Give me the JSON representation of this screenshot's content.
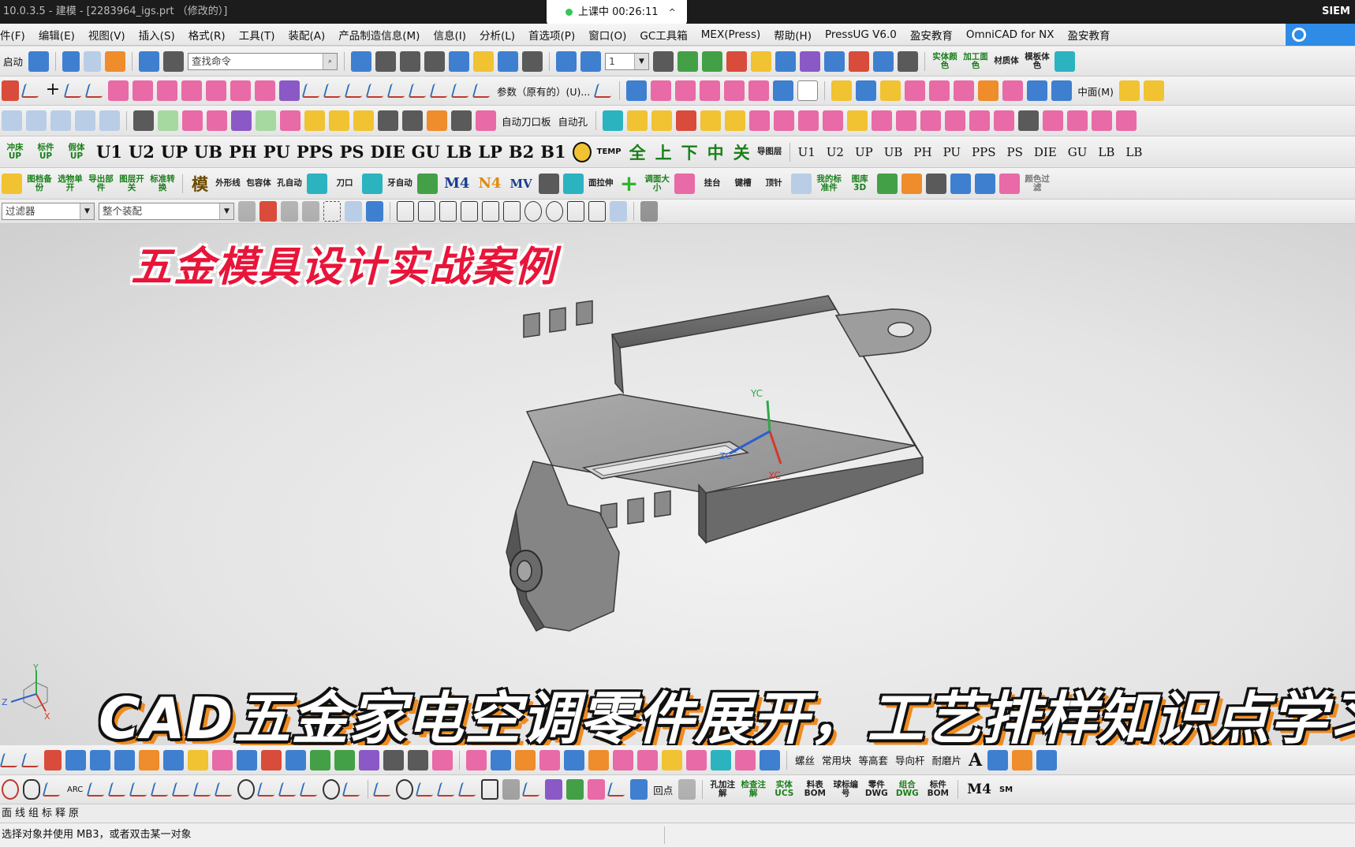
{
  "titlebar": {
    "title": "10.0.3.5 - 建模 - [2283964_igs.prt （修改的）]",
    "brand": "SIEM"
  },
  "recording": {
    "label": "上课中 00:26:11",
    "chevron": "^"
  },
  "menu": [
    "件(F)",
    "编辑(E)",
    "视图(V)",
    "插入(S)",
    "格式(R)",
    "工具(T)",
    "装配(A)",
    "产品制造信息(M)",
    "信息(I)",
    "分析(L)",
    "首选项(P)",
    "窗口(O)",
    "GC工具箱",
    "MEX(Press)",
    "帮助(H)",
    "PressUG V6.0",
    "盈安教育",
    "OmniCAD for NX",
    "盈安教育"
  ],
  "toolbar1": {
    "start_label": "启动",
    "search_placeholder": "查找命令",
    "layer_value": "1",
    "right_labels": [
      "实体颜色",
      "加工面色",
      "材质体",
      "模板体色"
    ]
  },
  "toolbar2": {
    "param_label": "参数（原有的）(U)...",
    "face_label": "中面(M)"
  },
  "toolbar3": {
    "auto_cut_label": "自动刀口板",
    "auto_hole_label": "自动孔"
  },
  "toolbar4": {
    "tags": [
      "冲床UP",
      "标件UP",
      "假体UP"
    ],
    "big": [
      "U1",
      "U2",
      "UP",
      "UB",
      "PH",
      "PU",
      "PPS",
      "PS",
      "DIE",
      "GU",
      "LB",
      "LP",
      "B2",
      "B1"
    ],
    "temp": "TEMP",
    "cn": [
      "全",
      "上",
      "下",
      "中",
      "关"
    ],
    "map_label": "导图层",
    "small": [
      "U1",
      "U2",
      "UP",
      "UB",
      "PH",
      "PU",
      "PPS",
      "PS",
      "DIE",
      "GU",
      "LB",
      "LB"
    ]
  },
  "toolbar5": {
    "labels": [
      "图档备份",
      "选物单开",
      "导出部件",
      "图层开关",
      "标准转换"
    ],
    "mold": "模",
    "mid": [
      "外形线",
      "包容体",
      "孔自动",
      "刀口",
      "牙自动"
    ],
    "m4": "M4",
    "n4": "N4",
    "mv": "MV",
    "right": [
      "面拉伸",
      "调面大小",
      "挂台",
      "键槽",
      "顶针",
      "我的标准件",
      "图库3D",
      "颜色过滤"
    ]
  },
  "filterbar": {
    "filter_value": "过滤器",
    "assembly_value": "整个装配"
  },
  "viewport": {
    "overlay_title": "五金模具设计实战案例",
    "overlay_caption": "CAD五金家电空调零件展开，工艺排样知识点学习",
    "axis": {
      "yc": "YC",
      "xc": "XC",
      "zc": "ZC",
      "triad_y": "Y",
      "triad_x": "X",
      "triad_z": "Z"
    }
  },
  "bottom_toolbar1": {
    "labels": [
      "螺丝",
      "常用块",
      "等高套",
      "导向杆",
      "耐磨片"
    ]
  },
  "bottom_toolbar2": {
    "labels": [
      "ARC",
      "回点",
      "孔加注解",
      "检查注解",
      "实体UCS",
      "料表BOM",
      "球标编号",
      "零件DWG",
      "组合DWG",
      "标件BOM"
    ],
    "m4": "M4",
    "sm": "SM"
  },
  "navbar": {
    "text": "面线组标释原"
  },
  "status": {
    "text": "选择对象并使用 MB3，或者双击某一对象"
  }
}
